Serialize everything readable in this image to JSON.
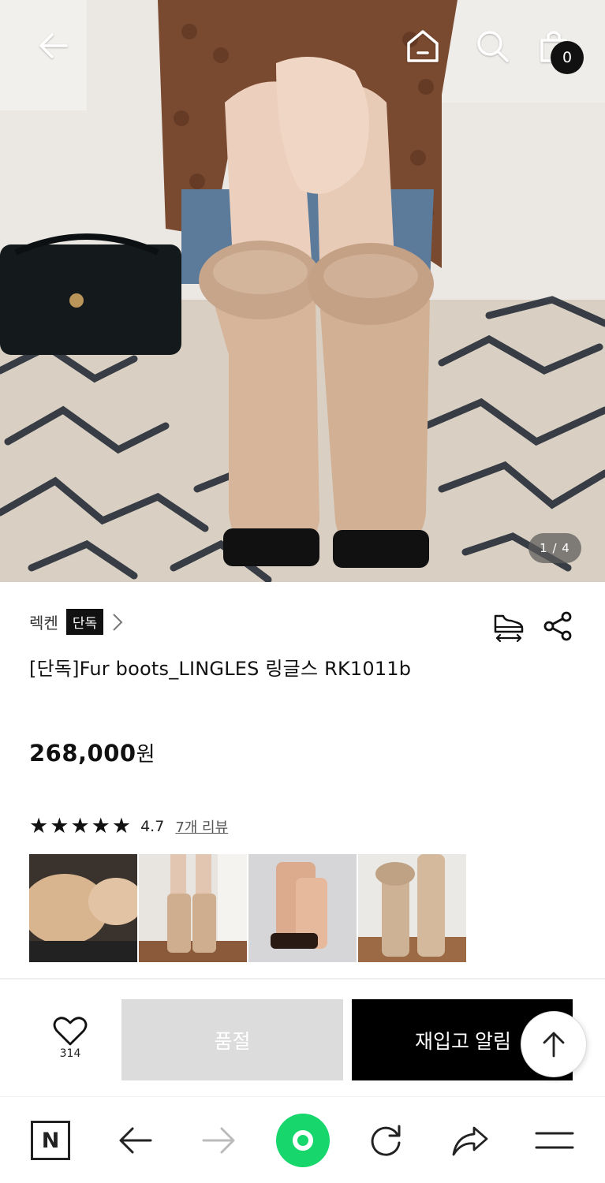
{
  "hero": {
    "counter": "1 / 4",
    "cart_count": "0"
  },
  "product": {
    "brand": "렉켄",
    "brand_tag": "단독",
    "title": "[단독]Fur boots_LINGLES 링글스 RK1011b",
    "price": "268,000",
    "currency": "원",
    "rating": 4.7,
    "rating_text": "4.7",
    "review_link": "7개 리뷰",
    "stars": 5
  },
  "reviews": {
    "thumbnails": [
      "review-photo-1",
      "review-photo-2",
      "review-photo-3",
      "review-photo-4"
    ]
  },
  "actions": {
    "like_count": "314",
    "soldout_label": "품절",
    "restock_label": "재입고 알림"
  },
  "icons": {
    "back": "arrow-left-icon",
    "home": "home-icon",
    "search": "search-icon",
    "cart": "shopping-bag-icon",
    "size": "shoe-size-icon",
    "share": "share-icon",
    "like": "heart-icon",
    "scroll_top": "arrow-up-icon"
  },
  "colors": {
    "accent_green": "#17d66b",
    "button_black": "#000000",
    "button_disabled": "#dcdcdc"
  }
}
